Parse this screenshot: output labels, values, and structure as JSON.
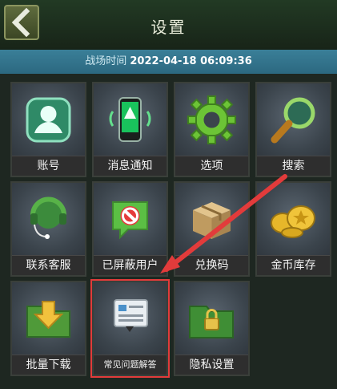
{
  "header": {
    "title": "设置",
    "back_icon": "back-arrow-icon"
  },
  "battle_time": {
    "label": "战场时间",
    "value": "2022-04-18 06:09:36"
  },
  "tiles": [
    {
      "label": "账号",
      "icon": "account-icon"
    },
    {
      "label": "消息通知",
      "icon": "phone-notification-icon"
    },
    {
      "label": "选项",
      "icon": "gear-icon"
    },
    {
      "label": "搜索",
      "icon": "search-icon"
    },
    {
      "label": "联系客服",
      "icon": "headset-icon"
    },
    {
      "label": "已屏蔽用户",
      "icon": "blocked-user-icon"
    },
    {
      "label": "兑换码",
      "icon": "package-icon"
    },
    {
      "label": "金币库存",
      "icon": "gold-coins-icon"
    },
    {
      "label": "批量下载",
      "icon": "folder-download-icon"
    },
    {
      "label": "常见问题解答",
      "icon": "faq-icon"
    },
    {
      "label": "隐私设置",
      "icon": "folder-lock-icon"
    }
  ],
  "colors": {
    "accent_blue": "#2c6880",
    "highlight_red": "#e23b3b"
  }
}
